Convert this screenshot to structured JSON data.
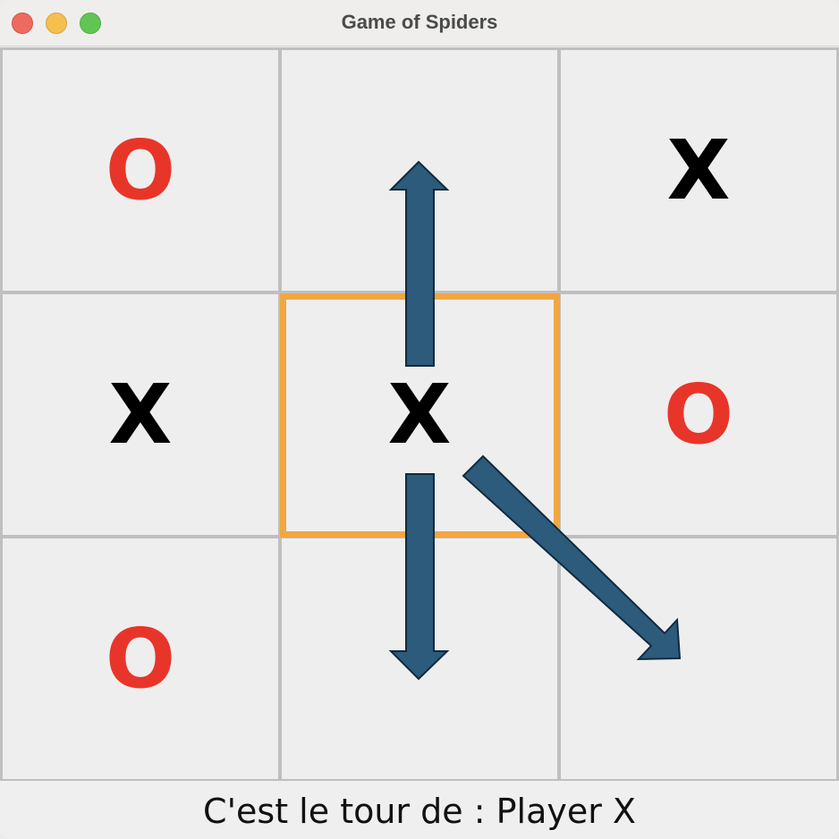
{
  "window": {
    "title": "Game of Spiders",
    "controls": [
      "close",
      "minimize",
      "zoom"
    ]
  },
  "board": {
    "cells": [
      {
        "id": "r0c0",
        "value": "O",
        "player_color": "#e8352a"
      },
      {
        "id": "r0c1",
        "value": ""
      },
      {
        "id": "r0c2",
        "value": "X",
        "player_color": "#000000"
      },
      {
        "id": "r1c0",
        "value": "X",
        "player_color": "#000000"
      },
      {
        "id": "r1c1",
        "value": "X",
        "player_color": "#000000",
        "selected": true
      },
      {
        "id": "r1c2",
        "value": "O",
        "player_color": "#e8352a"
      },
      {
        "id": "r2c0",
        "value": "O",
        "player_color": "#e8352a"
      },
      {
        "id": "r2c1",
        "value": ""
      },
      {
        "id": "r2c2",
        "value": ""
      }
    ],
    "selection_color": "#f2a640",
    "move_arrow_color": "#2c5b7c",
    "move_arrows": [
      {
        "from": "r1c1",
        "to": "r0c1",
        "direction": "up"
      },
      {
        "from": "r1c1",
        "to": "r2c1",
        "direction": "down"
      },
      {
        "from": "r1c1",
        "to": "r2c2",
        "direction": "down-right"
      }
    ]
  },
  "status": {
    "text": "C'est le tour de : Player X"
  }
}
